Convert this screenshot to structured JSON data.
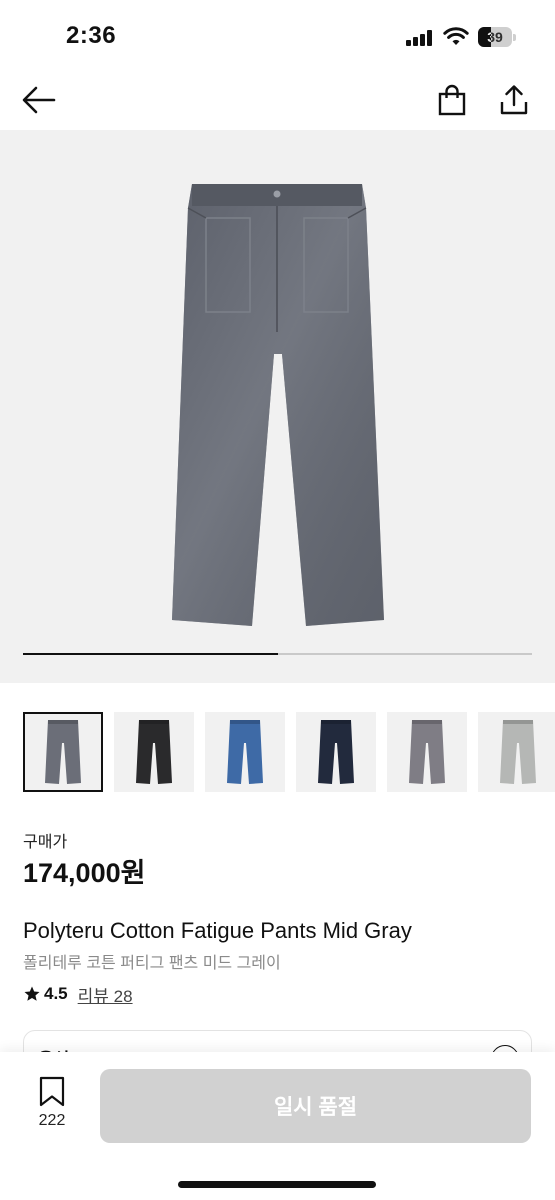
{
  "status_bar": {
    "time": "2:36",
    "battery": 39
  },
  "nav": {
    "back_icon": "arrow-left-icon",
    "bag_icon": "shopping-bag-icon",
    "share_icon": "share-icon"
  },
  "gallery": {
    "progress": 0.5,
    "thumbnails": [
      {
        "name": "mid-gray",
        "color": "#6b6e78",
        "selected": true
      },
      {
        "name": "black",
        "color": "#2a2a2c",
        "selected": false
      },
      {
        "name": "blue",
        "color": "#3e6aa6",
        "selected": false
      },
      {
        "name": "navy",
        "color": "#222a3d",
        "selected": false
      },
      {
        "name": "gray",
        "color": "#7f7d85",
        "selected": false
      },
      {
        "name": "light-gray",
        "color": "#b5b7b5",
        "selected": false
      }
    ]
  },
  "price": {
    "label": "구매가",
    "value": "174,000원"
  },
  "product": {
    "title": "Polyteru Cotton Fatigue Pants Mid Gray",
    "subtitle": "폴리테루 코튼 퍼티그 팬츠 미드 그레이"
  },
  "rating": {
    "score": "4.5",
    "review_link": "리뷰 28"
  },
  "options": {
    "label": "옵션"
  },
  "bottom_bar": {
    "wishlist_count": "222",
    "buy_button_label": "일시 품절"
  },
  "colors": {
    "button_disabled": "#d1d1d1",
    "hero_bg": "#f1f1f1"
  }
}
